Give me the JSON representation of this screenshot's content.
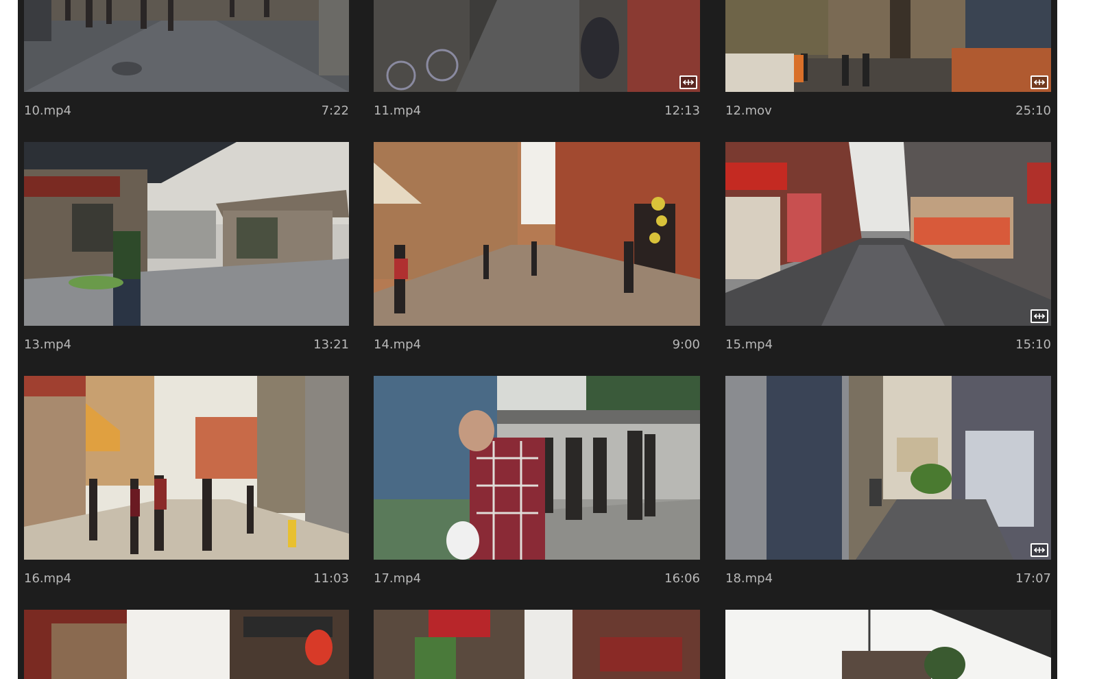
{
  "clips": [
    {
      "name": "10.mp4",
      "duration": "7:22",
      "multicam_badge": false,
      "scene": "crowded-paved-street",
      "badge_icon": "multicam-icon"
    },
    {
      "name": "11.mp4",
      "duration": "12:13",
      "multicam_badge": true,
      "scene": "alley-with-bicycle",
      "badge_icon": "multicam-icon"
    },
    {
      "name": "12.mov",
      "duration": "25:10",
      "multicam_badge": true,
      "scene": "street-with-cars-and-trees",
      "badge_icon": "multicam-icon"
    },
    {
      "name": "13.mp4",
      "duration": "13:21",
      "multicam_badge": false,
      "scene": "old-hutong-corner",
      "badge_icon": "multicam-icon"
    },
    {
      "name": "14.mp4",
      "duration": "9:00",
      "multicam_badge": false,
      "scene": "european-arcade-street",
      "badge_icon": "multicam-icon"
    },
    {
      "name": "15.mp4",
      "duration": "15:10",
      "multicam_badge": true,
      "scene": "wet-shopping-street",
      "badge_icon": "multicam-icon"
    },
    {
      "name": "16.mp4",
      "duration": "11:03",
      "multicam_badge": false,
      "scene": "sunny-italian-lane",
      "badge_icon": "multicam-icon"
    },
    {
      "name": "17.mp4",
      "duration": "16:06",
      "multicam_badge": false,
      "scene": "man-in-plaid-shirt",
      "badge_icon": "multicam-icon"
    },
    {
      "name": "18.mp4",
      "duration": "17:07",
      "multicam_badge": true,
      "scene": "narrow-backstreet",
      "badge_icon": "multicam-icon"
    },
    {
      "name": "",
      "duration": "",
      "multicam_badge": false,
      "scene": "lantern-street",
      "badge_icon": "multicam-icon"
    },
    {
      "name": "",
      "duration": "",
      "multicam_badge": false,
      "scene": "shop-signs-street",
      "badge_icon": "multicam-icon"
    },
    {
      "name": "",
      "duration": "",
      "multicam_badge": false,
      "scene": "sky-and-rooftops",
      "badge_icon": "multicam-icon"
    }
  ],
  "colors": {
    "panel_background": "#1d1d1d",
    "label_text": "#b8b8b8",
    "badge": "#ffffff"
  }
}
